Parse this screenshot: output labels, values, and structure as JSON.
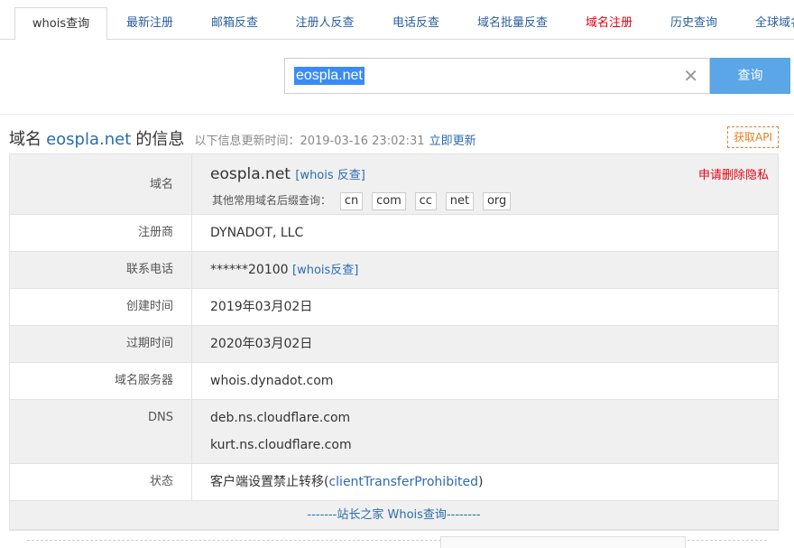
{
  "tabs": [
    {
      "label": "whois查询",
      "active": true
    },
    {
      "label": "最新注册"
    },
    {
      "label": "邮箱反查"
    },
    {
      "label": "注册人反查"
    },
    {
      "label": "电话反查"
    },
    {
      "label": "域名批量反查"
    },
    {
      "label": "域名注册",
      "color": "#e60012"
    },
    {
      "label": "历史查询"
    },
    {
      "label": "全球域名"
    }
  ],
  "search": {
    "value": "eospla.net",
    "button_label": "查询",
    "clear_icon": "close-icon"
  },
  "header": {
    "title_prefix": "域名",
    "domain": "eospla.net",
    "title_suffix": "的信息",
    "update_text": "以下信息更新时间：2019-03-16 23:02:31",
    "update_link": "立即更新",
    "api_button": "获取API"
  },
  "table": {
    "domain_label": "域名",
    "domain_value": "eospla.net",
    "whois_reverse_link": "[whois 反查]",
    "privacy_link": "申请删除隐私",
    "suffix_label": "其他常用域名后缀查询：",
    "suffixes": [
      "cn",
      "com",
      "cc",
      "net",
      "org"
    ],
    "registrar_label": "注册商",
    "registrar_value": "DYNADOT, LLC",
    "phone_label": "联系电话",
    "phone_value": "******20100",
    "phone_link": "[whois反查]",
    "created_label": "创建时间",
    "created_value": "2019年03月02日",
    "expire_label": "过期时间",
    "expire_value": "2020年03月02日",
    "server_label": "域名服务器",
    "server_value": "whois.dynadot.com",
    "dns_label": "DNS",
    "dns_values": [
      "deb.ns.cloudflare.com",
      "kurt.ns.cloudflare.com"
    ],
    "status_label": "状态",
    "status_prefix": "客户端设置禁止转移(",
    "status_link": "clientTransferProhibited",
    "status_suffix": ")",
    "footer_text": "-------站长之家 Whois查询--------"
  },
  "colors": {
    "link": "#2b6cb0",
    "accent_red": "#e60012",
    "search_button": "#5aa6e6",
    "api_orange": "#e67e22"
  }
}
